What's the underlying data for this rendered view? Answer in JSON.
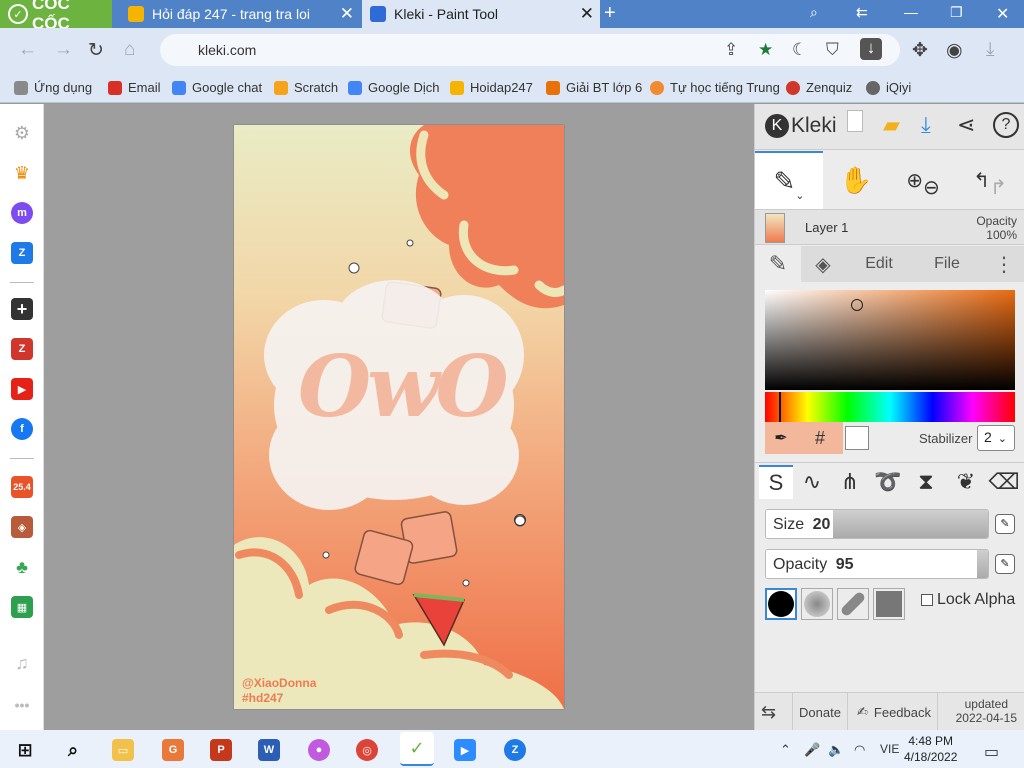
{
  "browser": {
    "brand": "CỐC CỐC",
    "tabs": [
      {
        "title": "Hỏi đáp 247 - trang tra loi",
        "fav_color": "#f5b400"
      },
      {
        "title": "Kleki - Paint Tool",
        "fav_color": "#2e6bd6"
      }
    ],
    "url": "kleki.com",
    "bookmarks": [
      {
        "label": "Ứng dụng",
        "icon": "apps-icon",
        "color": "#8a8a8a"
      },
      {
        "label": "Email",
        "icon": "gmail-icon",
        "color": "#d93025"
      },
      {
        "label": "Google chat",
        "icon": "google-icon",
        "color": "#4285f4"
      },
      {
        "label": "Scratch",
        "icon": "scratch-icon",
        "color": "#f7a21b"
      },
      {
        "label": "Google Dịch",
        "icon": "translate-icon",
        "color": "#4285f4"
      },
      {
        "label": "Hoidap247",
        "icon": "hoidap-icon",
        "color": "#f5b400"
      },
      {
        "label": "Giải BT lớp 6",
        "icon": "j-icon",
        "color": "#e8710a"
      },
      {
        "label": "Tự học tiếng Trung",
        "icon": "chinese-icon",
        "color": "#f28b30"
      },
      {
        "label": "Zenquiz",
        "icon": "zenquiz-icon",
        "color": "#d0362b"
      },
      {
        "label": "iQiyi",
        "icon": "iqiyi-icon",
        "color": "#666666"
      }
    ]
  },
  "artwork": {
    "main_text": "OwO",
    "credit": "@XiaoDonna",
    "tag": "#hd247"
  },
  "kleki": {
    "logo": "Kleki",
    "layer_name": "Layer 1",
    "opacity_label": "Opacity",
    "opacity_value": "100%",
    "tabs": [
      "Edit",
      "File"
    ],
    "hash": "#",
    "stabilizer_label": "Stabilizer",
    "stabilizer_value": "2",
    "size_label": "Size",
    "size_value": "20",
    "brush_opacity_label": "Opacity",
    "brush_opacity_value": "95",
    "size_fraction": 0.3,
    "brush_opacity_fraction": 0.95,
    "lock_alpha": "Lock Alpha",
    "donate": "Donate",
    "feedback": "Feedback",
    "updated_label": "updated",
    "updated_date": "2022-04-15",
    "accent": "#3b86d8",
    "current_color": "#ffffff"
  },
  "taskbar": {
    "lang": "VIE",
    "time": "4:48 PM",
    "date": "4/18/2022"
  }
}
